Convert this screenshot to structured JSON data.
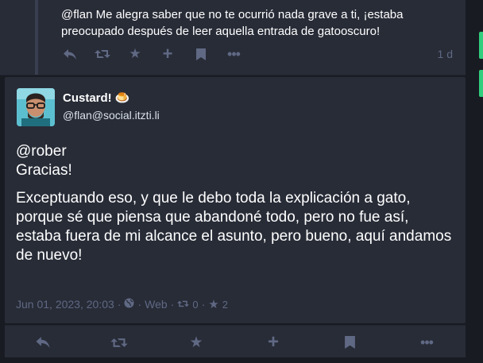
{
  "reply": {
    "text": "@flan Me alegra saber que no te ocurrió nada grave a ti, ¡estaba\npreocupado después de leer aquella entrada de gatooscuro!",
    "time": "1 d",
    "actions": {
      "reply_icon": "reply-icon",
      "boost_icon": "boost-icon",
      "favourite_icon": "star-icon",
      "more_icon": "plus-icon",
      "bookmark_icon": "bookmark-icon",
      "menu_icon": "ellipsis-icon"
    }
  },
  "status": {
    "display_name": "Custard! 🍮",
    "acct": "@flan@social.itzti.li",
    "paragraphs": [
      "@rober\nGracias!",
      "Exceptuando eso, y que le debo toda la explicación a gato, porque sé que piensa que abandoné todo, pero no fue así, estaba fuera de mi alcance el asunto, pero bueno, aquí andamos de nuevo!"
    ],
    "meta": {
      "date": "Jun 01, 2023, 20:03",
      "sep1": "·",
      "visibility_icon": "globe-icon",
      "sep2": "·",
      "application": "Web",
      "sep3": "·",
      "boosts": "0",
      "sep4": "·",
      "favourites": "2"
    }
  },
  "colors": {
    "background": "#191b22",
    "card": "#282c37",
    "muted": "#606984",
    "accent_green": "#30ce7d"
  }
}
